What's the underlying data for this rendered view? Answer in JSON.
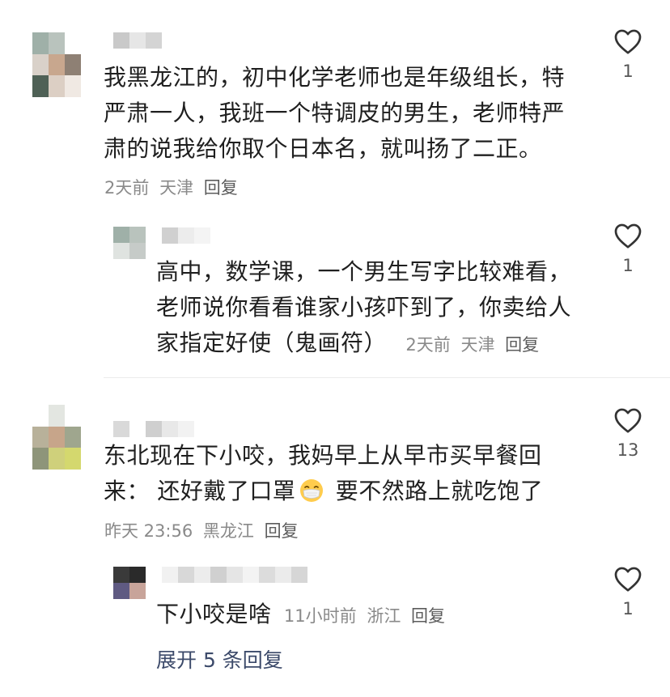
{
  "comments": [
    {
      "text_lines": [
        "我黑龙江的，初中化学老师也是年级组长，特",
        "严肃一人，我班一个特调皮的男生，老师特严",
        "肃的说我给你取个日本名，就叫扬了二正。"
      ],
      "time": "2天前",
      "location": "天津",
      "reply_label": "回复",
      "likes": "1",
      "replies": [
        {
          "text_lines": [
            "高中，数学课，一个男生写字比较难看，",
            "老师说你看看谁家小孩吓到了，你卖给人",
            "家指定好使（鬼画符）"
          ],
          "time": "2天前",
          "location": "天津",
          "reply_label": "回复",
          "likes": "1"
        }
      ]
    },
    {
      "text_line1": "东北现在下小咬，我妈早上从早市买早餐回",
      "text_line2_a": "来：  还好戴了口罩",
      "text_line2_b": " 要不然路上就吃饱了",
      "time": "昨天 23:56",
      "location": "黑龙江",
      "reply_label": "回复",
      "likes": "13",
      "replies": [
        {
          "text": "下小咬是啥",
          "time": "11小时前",
          "location": "浙江",
          "reply_label": "回复",
          "likes": "1"
        }
      ],
      "expand_label": "展开 5 条回复"
    }
  ],
  "colors": {
    "text": "#1f1f1f",
    "meta": "#8a8a8a",
    "expand": "#3c4a6a",
    "heart": "#333333"
  },
  "icons": {
    "like": "heart-outline-icon",
    "emoji": "mask-face-emoji-icon"
  }
}
